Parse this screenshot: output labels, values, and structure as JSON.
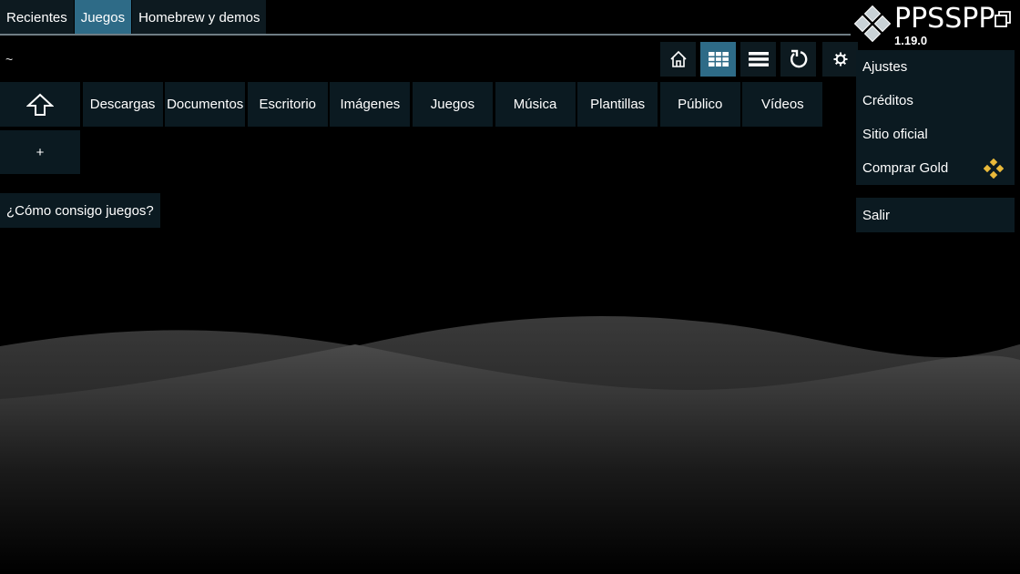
{
  "tabs": [
    {
      "label": "Recientes",
      "active": false
    },
    {
      "label": "Juegos",
      "active": true
    },
    {
      "label": "Homebrew y demos",
      "active": false
    }
  ],
  "path": "~",
  "toolbar": {
    "icons": [
      "home-icon",
      "grid-view-icon",
      "list-view-icon",
      "refresh-icon",
      "settings-gear-icon"
    ],
    "active_view": "grid"
  },
  "folders": [
    {
      "label": "",
      "icon": "up-arrow-icon"
    },
    {
      "label": "Descargas"
    },
    {
      "label": "Documentos"
    },
    {
      "label": "Escritorio"
    },
    {
      "label": "Imágenes"
    },
    {
      "label": "Juegos"
    },
    {
      "label": "Música"
    },
    {
      "label": "Plantillas"
    },
    {
      "label": "Público"
    },
    {
      "label": "Vídeos"
    }
  ],
  "add_button": "+",
  "help_button": "¿Cómo consigo juegos?",
  "app": {
    "name": "PPSSPP",
    "version": "1.19.0"
  },
  "menu": {
    "items": [
      "Ajustes",
      "Créditos",
      "Sitio oficial",
      "Comprar Gold"
    ],
    "exit": "Salir"
  },
  "colors": {
    "accent": "#2e6b87",
    "panel": "#0b1a21",
    "gold": "#e9b93a"
  }
}
